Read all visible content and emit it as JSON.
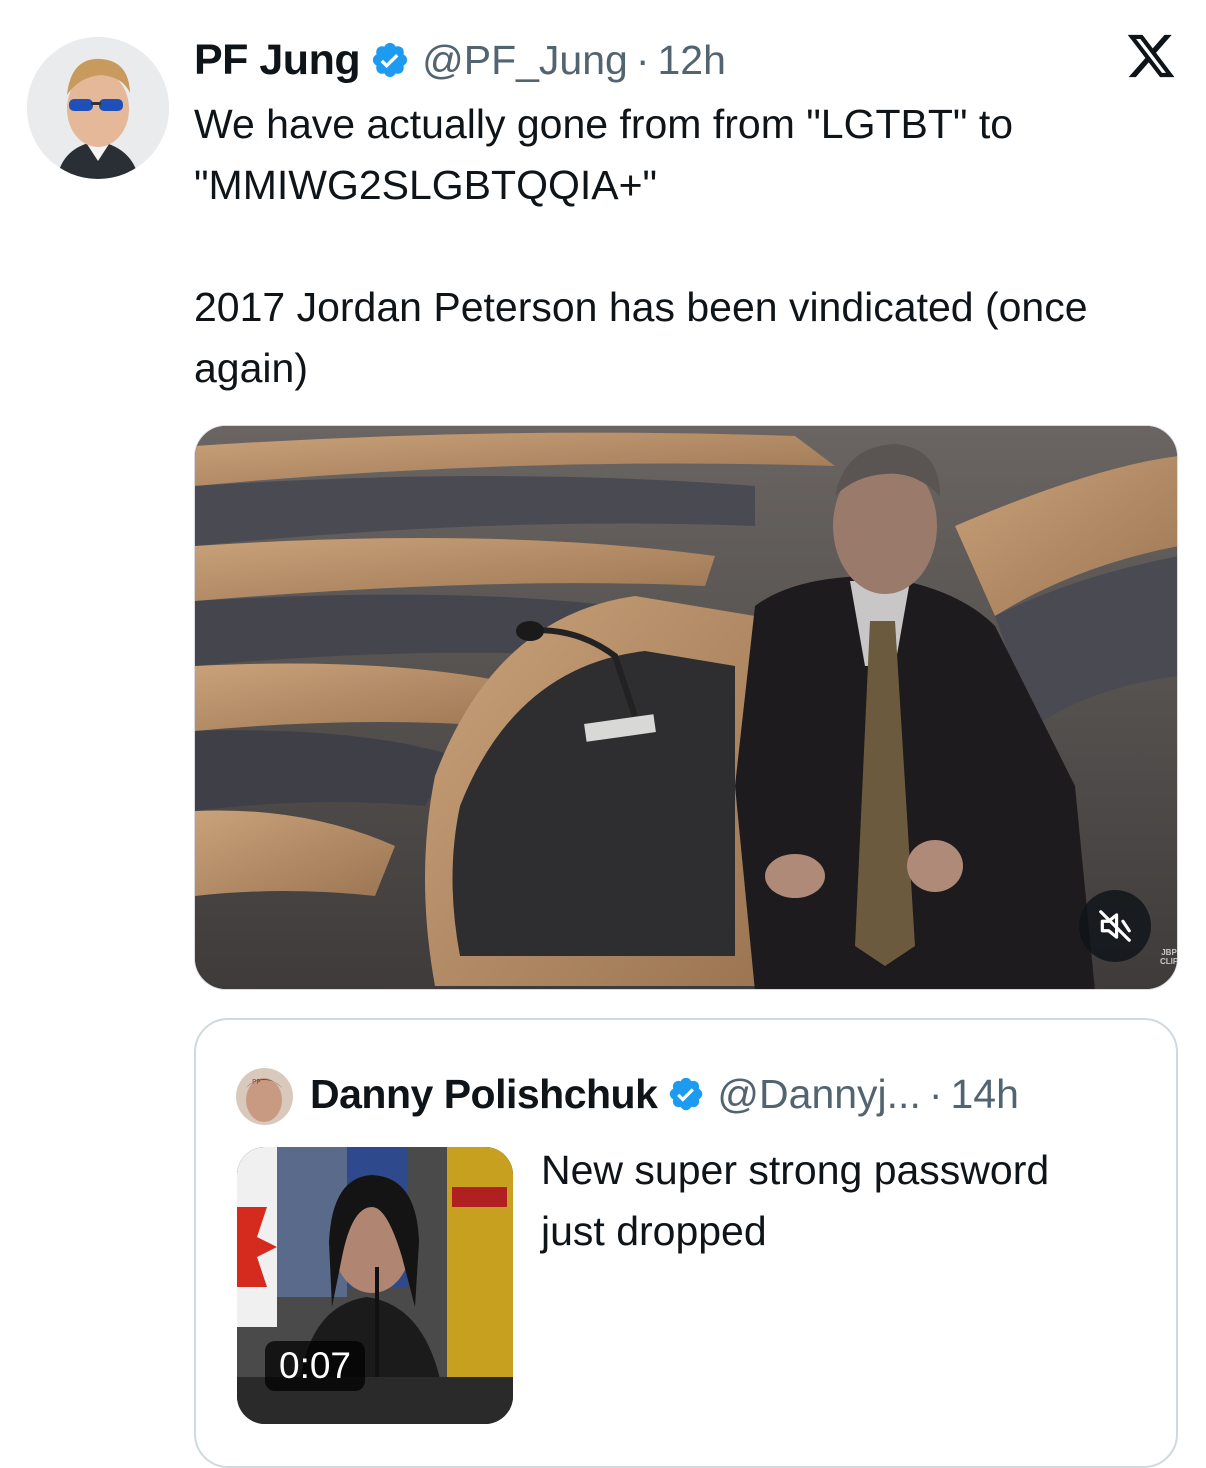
{
  "tweet": {
    "author": {
      "name": "PF Jung",
      "handle": "@PF_Jung",
      "time": "12h",
      "verified_icon": "verified-badge-icon",
      "avatar": "avatar-photo"
    },
    "text_lines": [
      "We have actually gone from from \"LGTBT\" to \"MMIWG2SLGBTQQIA+\"",
      "2017 Jordan Peterson has been vindicated (once again)"
    ],
    "separator": "·",
    "video": {
      "mute_icon": "muted-speaker-icon",
      "watermark": "JBP CLIP"
    }
  },
  "brand": {
    "logo": "x-logo-icon"
  },
  "quote": {
    "author": {
      "name": "Danny Polishchuk",
      "handle": "@Dannyj...",
      "time": "14h",
      "verified_icon": "verified-badge-icon"
    },
    "separator": "·",
    "text": "New super strong password just dropped",
    "media": {
      "duration": "0:07"
    }
  },
  "colors": {
    "verified_blue": "#1d9bf0",
    "secondary_text": "#536471",
    "border": "#cfd9de"
  }
}
